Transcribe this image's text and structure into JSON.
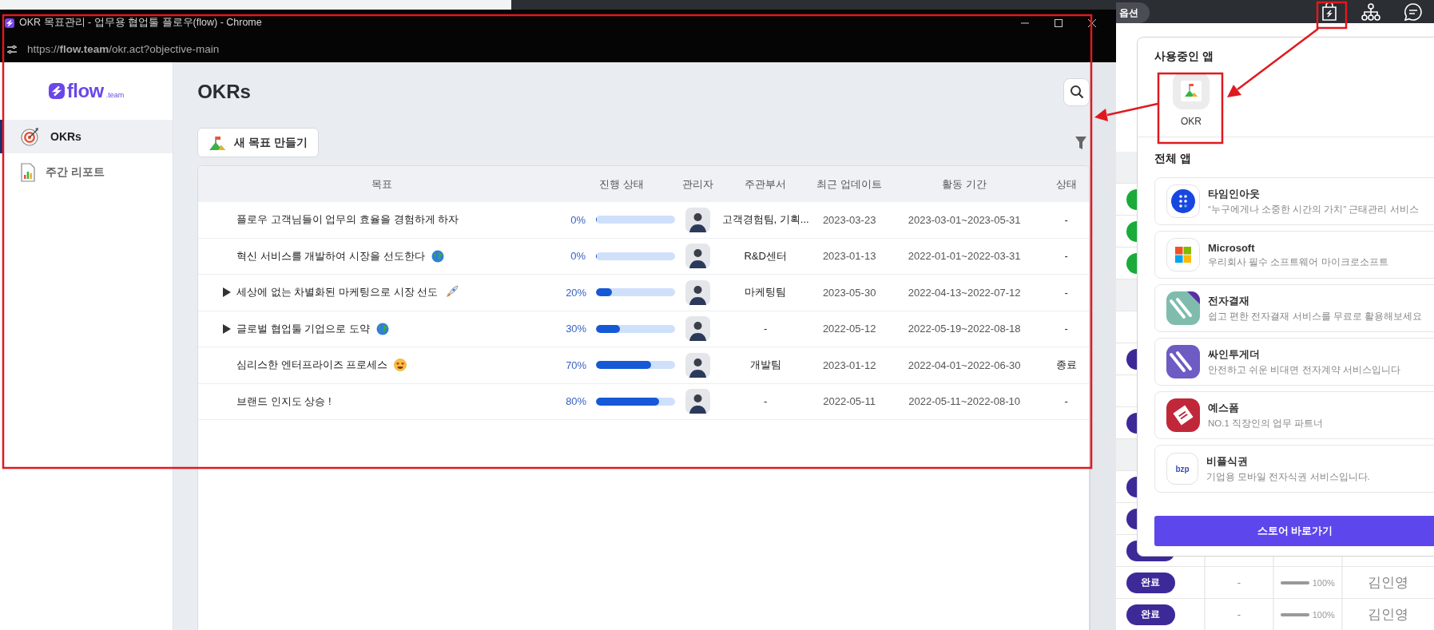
{
  "background": {
    "search_field": {
      "text": "옵션"
    },
    "rows": [
      {
        "kind": "band"
      },
      {
        "kind": "item",
        "color": "#1aab3a"
      },
      {
        "kind": "item",
        "color": "#1aab3a"
      },
      {
        "kind": "item",
        "color": "#1aab3a"
      },
      {
        "kind": "band"
      },
      {
        "kind": "blank"
      },
      {
        "kind": "item",
        "color": "#3d2a98"
      },
      {
        "kind": "blank"
      },
      {
        "kind": "item",
        "color": "#3d2a98"
      },
      {
        "kind": "band"
      },
      {
        "kind": "item",
        "color": "#3d2a98"
      },
      {
        "kind": "item",
        "color": "#3d2a98"
      },
      {
        "kind": "item",
        "color": "#3d2a98"
      },
      {
        "kind": "item",
        "color": "#3d2a98",
        "badge": "완료",
        "column_2": "-",
        "progress": "100%",
        "level": 1,
        "assignee": "김인영"
      },
      {
        "kind": "item",
        "color": "#3d2a98",
        "badge": "완료",
        "column_2": "-",
        "progress": "100%",
        "level": 1,
        "assignee": "김인영"
      }
    ]
  },
  "window": {
    "title": "OKR 목표관리 - 업무용 협업툴 플로우(flow) - Chrome",
    "url": "https://**flow.team**/okr.act?objective-main"
  },
  "sidebar": {
    "logo": {
      "word": "flow",
      "suffix": ".team"
    },
    "items": [
      {
        "label": "OKRs",
        "selected": true
      },
      {
        "label": "주간 리포트",
        "selected": false
      }
    ]
  },
  "main": {
    "heading": "OKRs",
    "new_button": "새 목표 만들기",
    "table": {
      "columns": [
        "목표",
        "진행 상태",
        "관리자",
        "주관부서",
        "최근 업데이트",
        "활동 기간",
        "상태"
      ],
      "rows": [
        {
          "goal": "플로우 고객님들이 업무의 효율을 경험하게 하자",
          "has_children": false,
          "percent": "0%",
          "level": 0,
          "department": "고객경험팀, 기획...",
          "updated": "2023-03-23",
          "period": "2023-03-01~2023-05-31",
          "status": "-"
        },
        {
          "goal": "혁신 서비스를 개발하여 시장을 선도한다",
          "has_children": false,
          "percent": "0%",
          "level": 0,
          "department": "R&D센터",
          "updated": "2023-01-13",
          "period": "2022-01-01~2022-03-31",
          "status": "-"
        },
        {
          "goal": "세상에 없는 차별화된 마케팅으로 시장 선도",
          "has_children": true,
          "percent": "20%",
          "level": 0.2,
          "department": "마케팅팀",
          "updated": "2023-05-30",
          "period": "2022-04-13~2022-07-12",
          "status": "-"
        },
        {
          "goal": "글로벌 협업툴 기업으로 도약",
          "has_children": true,
          "percent": "30%",
          "level": 0.3,
          "department": "-",
          "updated": "2022-05-12",
          "period": "2022-05-19~2022-08-18",
          "status": "-"
        },
        {
          "goal": "심리스한 엔터프라이즈 프로세스",
          "has_children": false,
          "percent": "70%",
          "level": 0.7,
          "department": "개발팀",
          "updated": "2023-01-12",
          "period": "2022-04-01~2022-06-30",
          "status": "종료"
        },
        {
          "goal": "브랜드 인지도 상승 !",
          "has_children": false,
          "percent": "80%",
          "level": 0.8,
          "department": "-",
          "updated": "2022-05-11",
          "period": "2022-05-11~2022-08-10",
          "status": "-"
        }
      ]
    }
  },
  "panel": {
    "in_use_title": "사용중인 앱",
    "in_use_apps": [
      {
        "name": "OKR"
      }
    ],
    "all_title": "전체 앱",
    "apps": [
      {
        "name": "타임인아웃",
        "description": "“누구에게나 소중한 시간의 가치” 근태관리 서비스",
        "kind": "dots",
        "color": "#1747e0"
      },
      {
        "name": "Microsoft",
        "description": "우리회사 필수 소프트웨어 마이크로소프트",
        "kind": "four-squares"
      },
      {
        "name": "전자결재",
        "description": "쉽고 편한 전자결재 서비스를 무료로 활용해보세요",
        "kind": "stripes",
        "color": "#7fbcae",
        "ribbon": true
      },
      {
        "name": "싸인투게더",
        "description": "안전하고 쉬운 비대면 전자계약 서비스입니다",
        "kind": "stripes",
        "color": "#6e5bc4",
        "ribbon": false
      },
      {
        "name": "예스폼",
        "description": "NO.1 직장인의 업무 파트너",
        "kind": "stamp",
        "color": "#c0283a"
      },
      {
        "name": "비플식권",
        "description": "기업용 모바일 전자식권 서비스입니다.",
        "kind": "wordmark",
        "wordmark": "bzp"
      }
    ],
    "store_button": "스토어 바로가기"
  }
}
